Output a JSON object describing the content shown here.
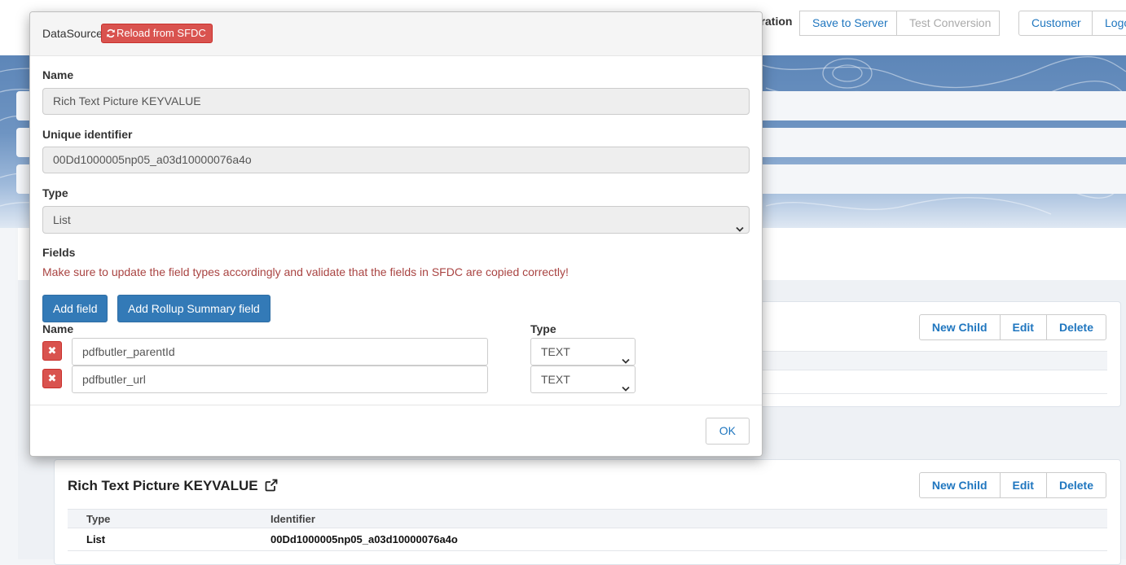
{
  "topbar": {
    "integration_text": "gration",
    "buttons": {
      "save_to_server": "Save to Server",
      "test_conversion": "Test Conversion",
      "customer": "Customer",
      "logout": "Logo"
    }
  },
  "card1": {
    "actions": {
      "new_child": "New Child",
      "edit": "Edit",
      "delete": "Delete"
    }
  },
  "card2": {
    "title": "Rich Text Picture KEYVALUE",
    "title_icon": "external-link-icon",
    "actions": {
      "new_child": "New Child",
      "edit": "Edit",
      "delete": "Delete"
    },
    "table": {
      "headers": {
        "type": "Type",
        "identifier": "Identifier"
      },
      "rows": [
        {
          "type": "List",
          "identifier": "00Dd1000005np05_a03d10000076a4o"
        }
      ]
    }
  },
  "modal": {
    "title": "DataSource",
    "reload_button": "Reload from SFDC",
    "reload_icon": "refresh-icon",
    "name_label": "Name",
    "name_value": "Rich Text Picture KEYVALUE",
    "uid_label": "Unique identifier",
    "uid_value": "00Dd1000005np05_a03d10000076a4o",
    "type_label": "Type",
    "type_value": "List",
    "fields_label": "Fields",
    "warning": "Make sure to update the field types accordingly and validate that the fields in SFDC are copied correctly!",
    "add_field": "Add field",
    "add_rollup": "Add Rollup Summary field",
    "col_name": "Name",
    "col_type": "Type",
    "fields": [
      {
        "name": "pdfbutler_parentId",
        "type": "TEXT"
      },
      {
        "name": "pdfbutler_url",
        "type": "TEXT"
      }
    ],
    "ok": "OK"
  },
  "colors": {
    "primary": "#337ab7",
    "danger": "#d9534f",
    "link": "#1f76bf",
    "warning_text": "#a94442"
  }
}
